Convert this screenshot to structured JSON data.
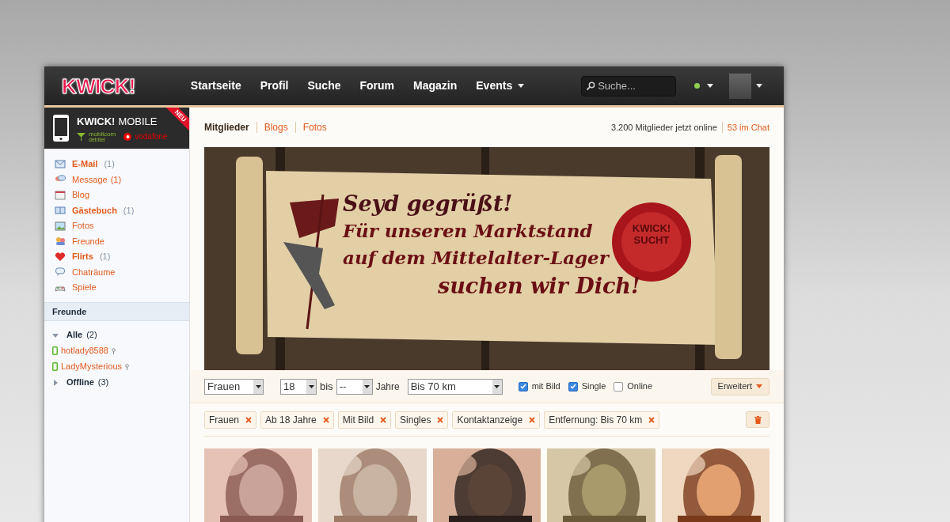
{
  "nav": {
    "logo": "KWICK!",
    "items": [
      {
        "label": "Startseite",
        "dropdown": false
      },
      {
        "label": "Profil",
        "dropdown": false
      },
      {
        "label": "Suche",
        "dropdown": false
      },
      {
        "label": "Forum",
        "dropdown": false
      },
      {
        "label": "Magazin",
        "dropdown": false
      },
      {
        "label": "Events",
        "dropdown": true
      }
    ],
    "search": {
      "placeholder": "Suche..."
    }
  },
  "promo": {
    "brand": "KWICK!",
    "title": "MOBILE",
    "badge": "NEU",
    "partners": [
      "mobilcom",
      "debitel",
      "vodafone"
    ]
  },
  "menu": [
    {
      "label": "E-Mail",
      "count": "(1)",
      "bold": true,
      "count_highlight": false
    },
    {
      "label": "Message",
      "count": "(1)",
      "bold": false,
      "count_highlight": true
    },
    {
      "label": "Blog",
      "bold": false
    },
    {
      "label": "Gästebuch",
      "count": "(1)",
      "bold": true,
      "count_highlight": false
    },
    {
      "label": "Fotos",
      "bold": false
    },
    {
      "label": "Freunde",
      "bold": false
    },
    {
      "label": "Flirts",
      "count": "(1)",
      "bold": true,
      "count_highlight": false
    },
    {
      "label": "Chaträume",
      "bold": false
    },
    {
      "label": "Spiele",
      "bold": false
    }
  ],
  "friends": {
    "title": "Freunde",
    "groups": [
      {
        "label": "Alle",
        "count": "(2)",
        "expanded": true,
        "children": [
          {
            "name": "hotlady8588"
          },
          {
            "name": "LadyMysterious"
          }
        ]
      },
      {
        "label": "Offline",
        "count": "(3)",
        "expanded": false
      }
    ]
  },
  "tabs": [
    {
      "label": "Mitglieder",
      "selected": true
    },
    {
      "label": "Blogs",
      "selected": false
    },
    {
      "label": "Fotos",
      "selected": false
    }
  ],
  "stats": {
    "online": "3.200 Mitglieder jetzt online",
    "chat": "53 im Chat"
  },
  "banner": {
    "lines": [
      "Seyd gegrüßt!",
      "Für unseren Marktstand",
      "auf dem Mittelalter-Lager",
      "suchen wir Dich!"
    ],
    "seal": [
      "KWICK!",
      "SUCHT"
    ]
  },
  "filters": {
    "gender": "Frauen",
    "age_from": "18",
    "between": "bis",
    "age_to": "--",
    "age_unit": "Jahre",
    "distance": "Bis 70 km",
    "checkboxes": [
      {
        "label": "mit Bild",
        "checked": true
      },
      {
        "label": "Single",
        "checked": true
      },
      {
        "label": "Online",
        "checked": false
      }
    ],
    "more": "Erweitert"
  },
  "tags": [
    "Frauen",
    "Ab 18 Jahre",
    "Mit Bild",
    "Singles",
    "Kontaktanzeige",
    "Entfernung: Bis 70 km"
  ]
}
